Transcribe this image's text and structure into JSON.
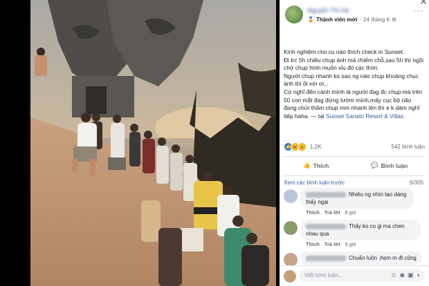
{
  "post": {
    "author": "Nguyễn Thị Hà",
    "badge": "Thành viên mới",
    "date": "24 tháng 6",
    "menu": "···",
    "close": "✕",
    "text_lines": [
      "Kinh nghiệm cho cụ nào thích check in Sunset.",
      "Đi trc 5h chiều chụp ảnh mà chiếm chỗ,sau 5h thì ngồi chờ chụp hình muốn xỉu đó các thím.",
      "Người chụp nhanh ko sao ng nào chụp khoảng chục ảnh thì ối xời ơi...",
      "Cứ nghĩ đến cảnh mình là người đag đc chụp mà trên 50 con mắt đag đứng lườm mình,mấy cục bộ não đang chửi thầm chụp mm nhanh lên thì e k dám nghĩ tiếp haha."
    ],
    "location_prefix": " — tại ",
    "location": "Sunset Sanato Resort & Villas."
  },
  "reactions": {
    "count": "1,2K",
    "comments": "542 bình luận",
    "icons": [
      "like-icon",
      "haha-icon",
      "wow-icon"
    ]
  },
  "actions": {
    "like": "Thích",
    "comment": "Bình luận"
  },
  "comments_section": {
    "view_previous": "Xem các bình luận trước",
    "counter": "6/305",
    "items": [
      {
        "text": "Nhiều ng nhìn tạo dáng thấy ngại",
        "like": "Thích",
        "reply": "Trả lời",
        "time": "8 giờ",
        "avatar_color": "#b8c6d9"
      },
      {
        "text": "Thấy ko co gi ma chen nhau qua",
        "like": "Thích",
        "reply": "Trả lời",
        "time": "9 giờ",
        "avatar_color": "#8a9b6a"
      },
      {
        "text": "Chuẩn luôn ,hẹm m đi cũng",
        "like": "",
        "reply": "",
        "time": "",
        "avatar_color": "#c9a38f"
      }
    ]
  },
  "input": {
    "placeholder": "Viết bình luận..."
  },
  "colors": {
    "link": "#385898",
    "text": "#1c1e21",
    "muted": "#606770"
  }
}
